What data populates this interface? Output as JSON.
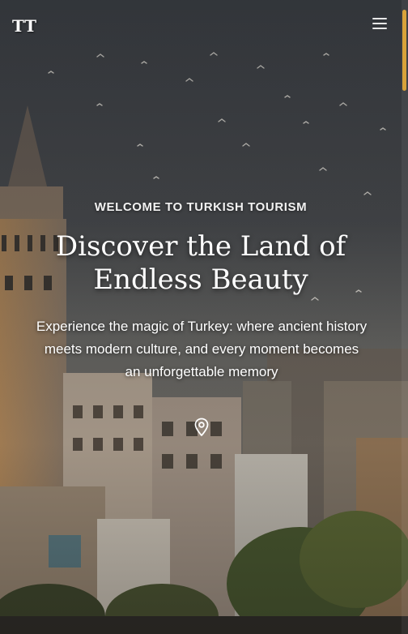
{
  "header": {
    "logo_text": "TT",
    "menu_icon": "hamburger-menu-icon"
  },
  "hero": {
    "eyebrow": "WELCOME TO TURKISH TOURISM",
    "title_line1": "Discover the Land of",
    "title_line2": "Endless Beauty",
    "subtitle_line1": "Experience the magic of Turkey: where ancient history",
    "subtitle_line2": "meets modern culture, and every moment becomes",
    "subtitle_line3": "an unforgettable memory",
    "location_icon": "map-pin-icon"
  },
  "colors": {
    "accent": "#d8a23a",
    "text": "#ffffff"
  }
}
